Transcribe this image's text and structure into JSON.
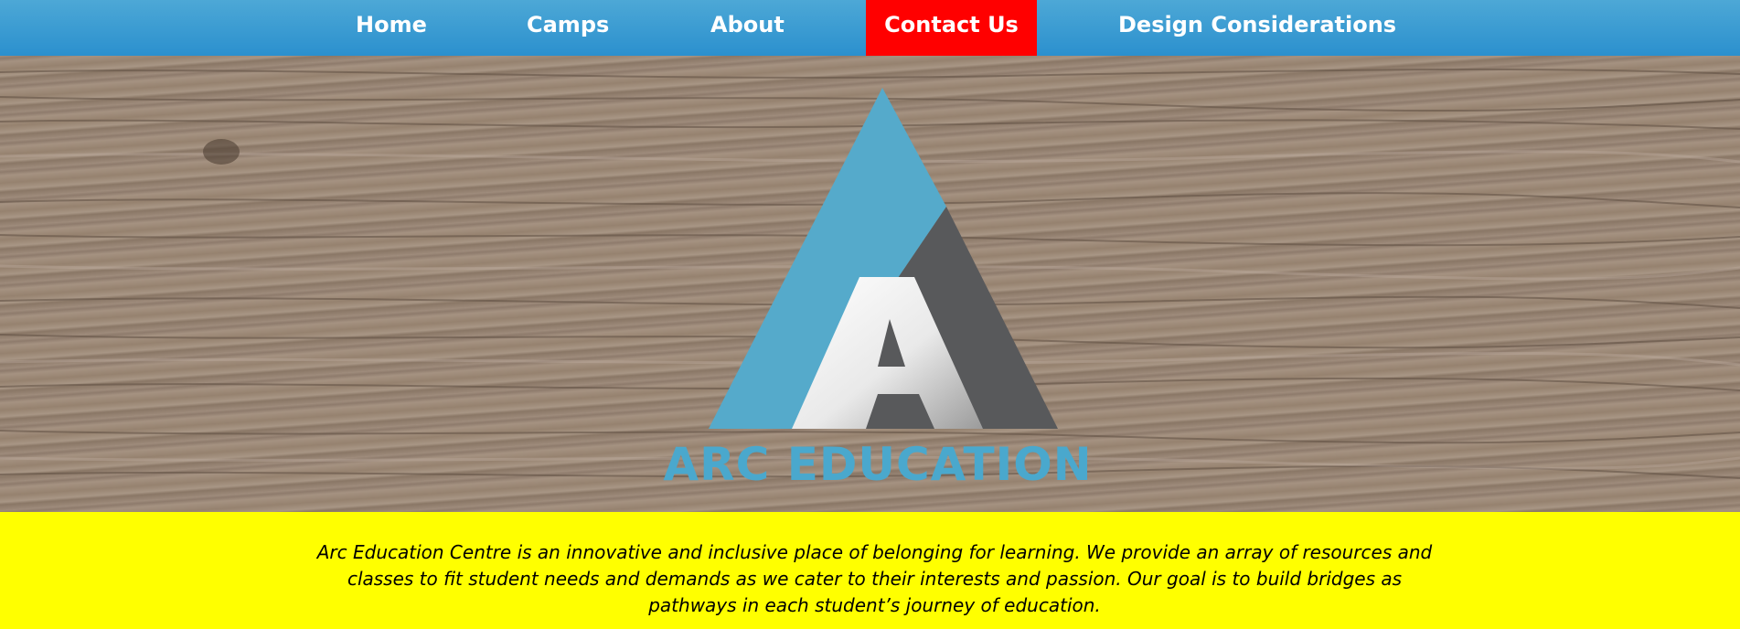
{
  "nav": {
    "items": [
      {
        "label": "Home"
      },
      {
        "label": "Camps"
      },
      {
        "label": "About"
      },
      {
        "label": "Contact Us",
        "active": true,
        "highlight_color": "#ff0000"
      },
      {
        "label": "Design Considerations"
      }
    ],
    "background_color": "#2b90ce"
  },
  "hero": {
    "background": "wood-planks",
    "logo": {
      "icon": "arc-triangle-logo",
      "text": "ARC EDUCATION",
      "colors": {
        "blue": "#55aacb",
        "gray": "#58595b",
        "white": "#ffffff"
      }
    }
  },
  "intro": {
    "text": "Arc Education Centre is an innovative and inclusive place of belonging for learning. We provide an array of resources and classes to fit student needs and demands as we cater to their interests and passion. Our goal is to build bridges as pathways in each student’s journey of education.",
    "background_color": "#ffff00"
  }
}
